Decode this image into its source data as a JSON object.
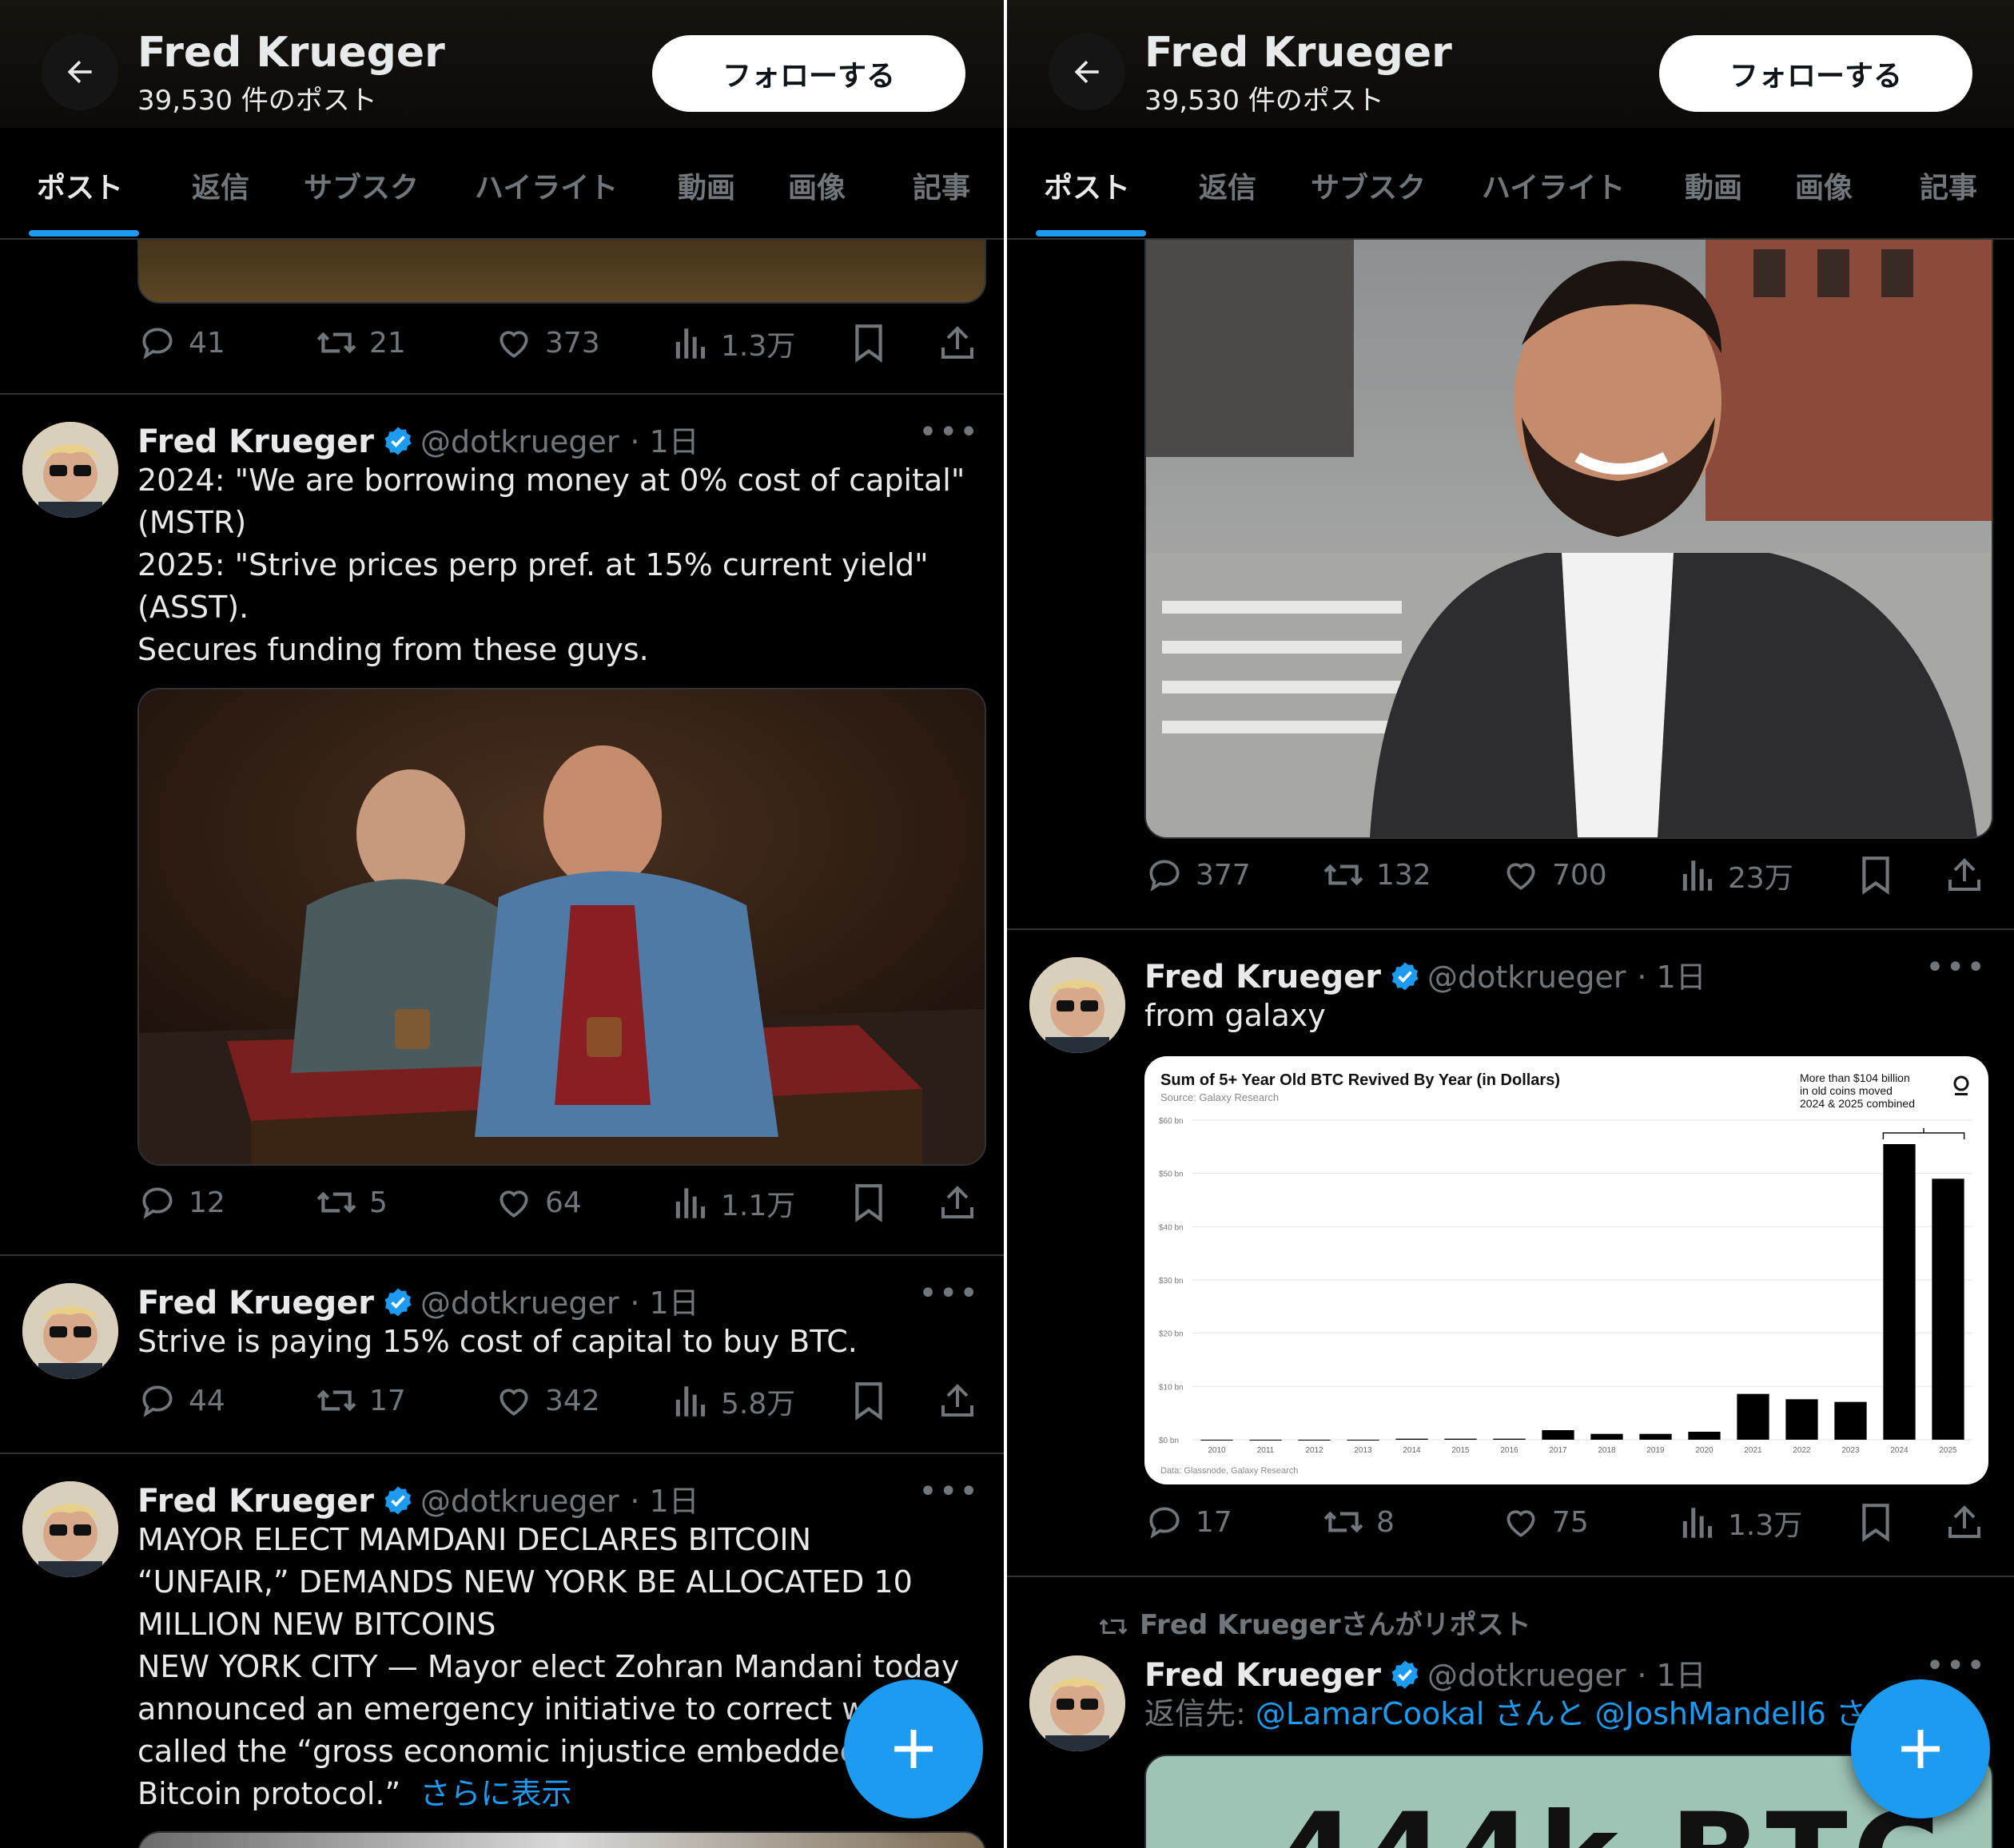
{
  "colors": {
    "accent": "#1d9bf0",
    "muted": "#71767b",
    "text": "#e7e9ea",
    "background": "#000000"
  },
  "profile": {
    "name": "Fred Krueger",
    "post_count": "39,530 件のポスト",
    "follow_label": "フォローする"
  },
  "tabs": [
    "ポスト",
    "返信",
    "サブスク",
    "ハイライト",
    "動画",
    "画像",
    "記事"
  ],
  "left": {
    "top_actions": {
      "replies": "41",
      "reposts": "21",
      "likes": "373",
      "views": "1.3万"
    },
    "posts": [
      {
        "name": "Fred Krueger",
        "handle": "@dotkrueger",
        "time": "· 1日",
        "text": "2024: \"We are borrowing money at 0% cost of capital\"\n(MSTR)\n2025: \"Strive prices perp pref. at 15% current yield\"\n(ASST).\nSecures funding from these guys.",
        "actions": {
          "replies": "12",
          "reposts": "5",
          "likes": "64",
          "views": "1.1万"
        }
      },
      {
        "name": "Fred Krueger",
        "handle": "@dotkrueger",
        "time": "· 1日",
        "text": "Strive is paying 15% cost of capital to buy BTC.",
        "actions": {
          "replies": "44",
          "reposts": "17",
          "likes": "342",
          "views": "5.8万"
        }
      },
      {
        "name": "Fred Krueger",
        "handle": "@dotkrueger",
        "time": "· 1日",
        "text": "MAYOR ELECT MAMDANI DECLARES BITCOIN\n“UNFAIR,” DEMANDS NEW YORK BE ALLOCATED 10\nMILLION NEW BITCOINS\nNEW YORK CITY — Mayor elect Zohran Mandani today\nannounced an emergency initiative to correct w\ncalled the “gross economic injustice embeddec\nBitcoin protocol.”",
        "show_more": "さらに表示"
      }
    ]
  },
  "right": {
    "top_actions": {
      "replies": "377",
      "reposts": "132",
      "likes": "700",
      "views": "23万"
    },
    "posts": [
      {
        "name": "Fred Krueger",
        "handle": "@dotkrueger",
        "time": "· 1日",
        "text": "from galaxy",
        "actions": {
          "replies": "17",
          "reposts": "8",
          "likes": "75",
          "views": "1.3万"
        }
      },
      {
        "repost_label": "Fred Kruegerさんがリポスト",
        "name": "Fred Krueger",
        "handle": "@dotkrueger",
        "time": "· 1日",
        "reply_prefix": "返信先: ",
        "reply_users": "@LamarCookal さんと @JoshMandell6 さ",
        "image_text": "444k BTC"
      }
    ]
  },
  "chart_data": {
    "type": "bar",
    "title": "Sum of 5+ Year Old BTC Revived By Year (in Dollars)",
    "subtitle": "Source: Galaxy Research",
    "footer": "Data: Glassnode, Galaxy Research",
    "annotation": "More than $104 billion\nin old coins moved\n2024 & 2025 combined",
    "categories": [
      "2010",
      "2011",
      "2012",
      "2013",
      "2014",
      "2015",
      "2016",
      "2017",
      "2018",
      "2019",
      "2020",
      "2021",
      "2022",
      "2023",
      "2024",
      "2025"
    ],
    "values": [
      0,
      0,
      0,
      0,
      0.2,
      0.2,
      0.2,
      1.8,
      1.1,
      1.1,
      1.5,
      8.6,
      7.6,
      7.1,
      55.5,
      49.0
    ],
    "y_ticks": [
      "$0 bn",
      "$10 bn",
      "$20 bn",
      "$30 bn",
      "$40 bn",
      "$50 bn",
      "$60 bn"
    ],
    "ylim": [
      0,
      60
    ],
    "grid": true,
    "unit": "bn"
  }
}
